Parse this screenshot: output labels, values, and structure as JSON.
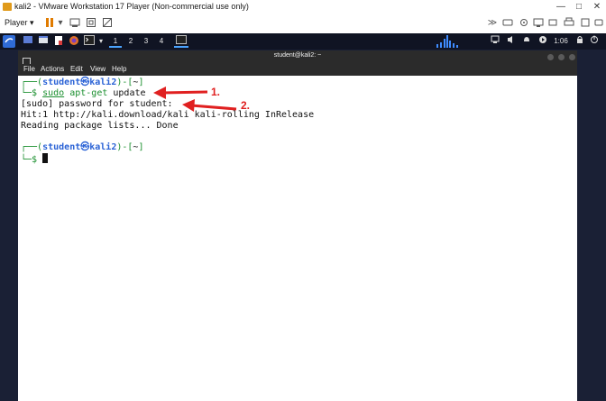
{
  "vmware": {
    "window_title": "kali2 - VMware Workstation 17 Player (Non-commercial use only)",
    "player_menu": "Player",
    "player_arrow": "▾",
    "window_buttons": [
      "—",
      "□",
      "✕"
    ]
  },
  "guest_panel": {
    "workspaces": [
      "1",
      "2",
      "3",
      "4"
    ],
    "active_workspace": "1",
    "clock": "1:06"
  },
  "terminal": {
    "title": "student@kali2: ~",
    "menu": [
      "File",
      "Actions",
      "Edit",
      "View",
      "Help"
    ],
    "prompt1": {
      "open": "┌──(",
      "user_host": "student㉿kali2",
      "mid": ")-[",
      "dir": "~",
      "close": "]",
      "arrow": "└─$ ",
      "cmd_sudo": "sudo",
      "cmd_apt": "apt-get",
      "cmd_arg": " update"
    },
    "output": [
      "[sudo] password for student:",
      "Hit:1 http://kali.download/kali kali-rolling InRelease",
      "Reading package lists... Done"
    ],
    "prompt2": {
      "open": "┌──(",
      "user_host": "student㉿kali2",
      "mid": ")-[",
      "dir": "~",
      "close": "]",
      "arrow": "└─$ "
    }
  },
  "annotations": {
    "step1": "1.",
    "step2": "2.",
    "color": "#e02020"
  },
  "colors": {
    "kali_green": "#1a8f2e",
    "kali_blue": "#2b63d6",
    "panel_bg": "#101423",
    "terminal_chrome": "#2b2b2b"
  }
}
